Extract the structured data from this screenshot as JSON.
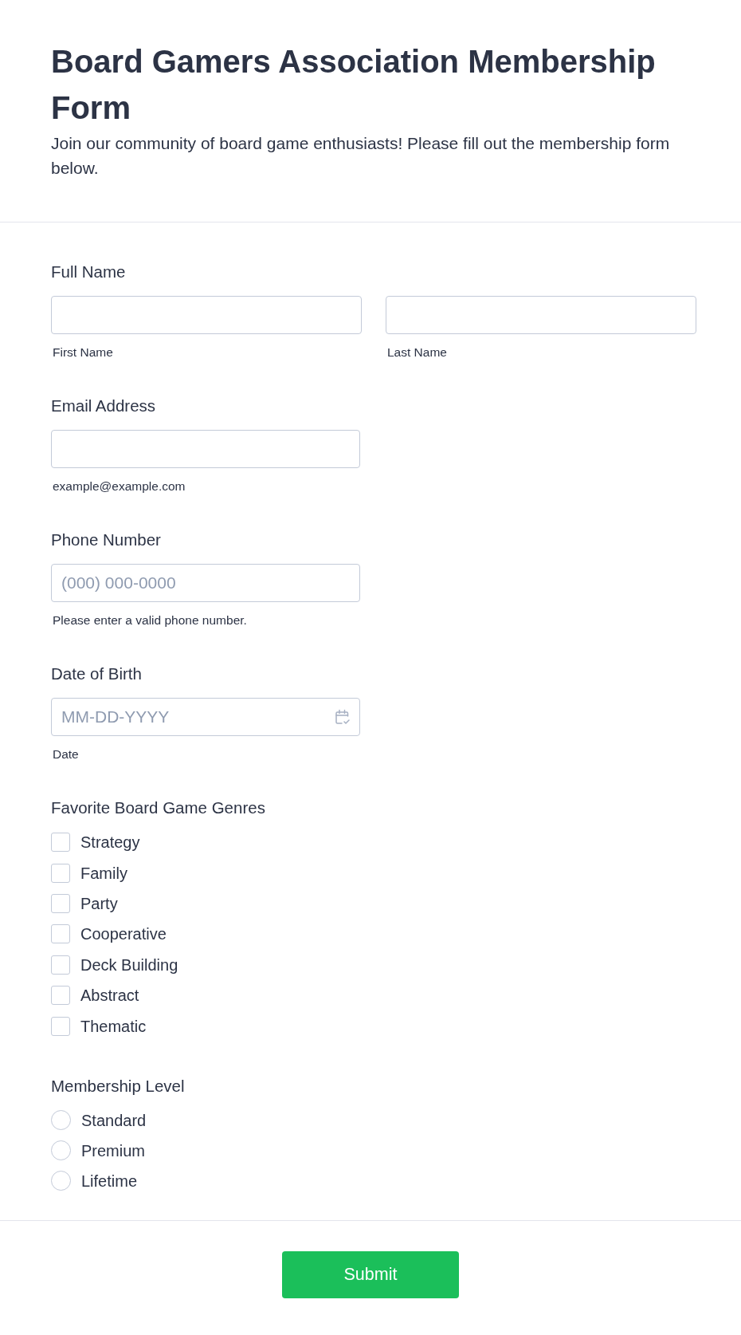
{
  "header": {
    "title": "Board Gamers Association Membership Form",
    "description": "Join our community of board game enthusiasts! Please fill out the membership form below."
  },
  "fields": [
    {
      "kind": "name",
      "label": "Full Name",
      "inputs": [
        {
          "sublabel": "First Name"
        },
        {
          "sublabel": "Last Name"
        }
      ]
    },
    {
      "kind": "text",
      "label": "Email Address",
      "sublabel": "example@example.com"
    },
    {
      "kind": "text",
      "label": "Phone Number",
      "placeholder": "(000) 000-0000",
      "sublabel": "Please enter a valid phone number."
    },
    {
      "kind": "date",
      "label": "Date of Birth",
      "placeholder": "MM-DD-YYYY",
      "sublabel": "Date"
    },
    {
      "kind": "checkboxes",
      "label": "Favorite Board Game Genres",
      "options": [
        {
          "label": "Strategy",
          "checked": false
        },
        {
          "label": "Family",
          "checked": false
        },
        {
          "label": "Party",
          "checked": false
        },
        {
          "label": "Cooperative",
          "checked": false
        },
        {
          "label": "Deck Building",
          "checked": false
        },
        {
          "label": "Abstract",
          "checked": false
        },
        {
          "label": "Thematic",
          "checked": false
        }
      ]
    },
    {
      "kind": "radios",
      "label": "Membership Level",
      "options": [
        {
          "label": "Standard",
          "selected": false
        },
        {
          "label": "Premium",
          "selected": false
        },
        {
          "label": "Lifetime",
          "selected": false
        }
      ]
    }
  ],
  "submit": {
    "label": "Submit"
  }
}
